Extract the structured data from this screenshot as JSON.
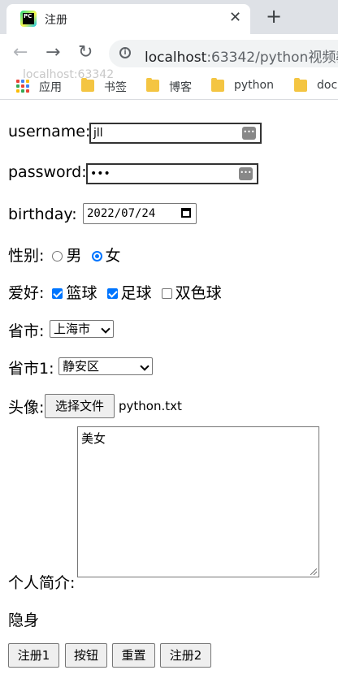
{
  "browser": {
    "tab_title": "注册",
    "tab_close": "✕",
    "new_tab": "+",
    "url_host": "localhost",
    "url_rest": ":63342/python视频教",
    "ghost_text": "localhost:63342",
    "bookmarks": [
      "应用",
      "书签",
      "博客",
      "python",
      "doc"
    ]
  },
  "form": {
    "username_label": "username:",
    "username_value": "jll",
    "password_label": "password:",
    "password_value": "•••",
    "birthday_label": "birthday:",
    "birthday_value": "2022/07/24",
    "gender_label": "性别:",
    "gender_options": [
      "男",
      "女"
    ],
    "gender_selected": "女",
    "hobby_label": "爱好:",
    "hobby_options": [
      "篮球",
      "足球",
      "双色球"
    ],
    "province_label": "省市:",
    "province_value": "上海市",
    "province1_label": "省市1:",
    "province1_value": "静安区",
    "avatar_label": "头像:",
    "file_button": "选择文件",
    "file_name": "python.txt",
    "bio_label": "个人简介:",
    "bio_value": "美女",
    "hidden_label": "隐身",
    "buttons": [
      "注册1",
      "按钮",
      "重置",
      "注册2"
    ]
  },
  "colors": {
    "accent": "#0075ff",
    "tabstrip": "#dee1e6"
  }
}
